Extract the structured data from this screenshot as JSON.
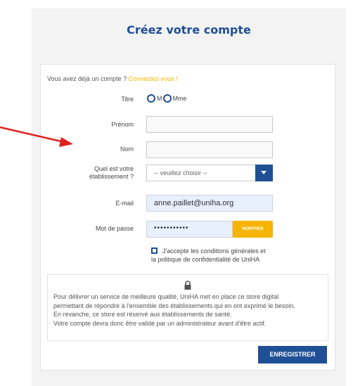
{
  "title": "Créez votre compte",
  "login_prompt": {
    "text": "Vous avez déjà un compte ?",
    "link": "Connectez-vous !"
  },
  "fields": {
    "titre": {
      "label": "Titre",
      "options": [
        "M",
        "Mme"
      ]
    },
    "prenom": {
      "label": "Prénom",
      "value": ""
    },
    "nom": {
      "label": "Nom",
      "value": ""
    },
    "etablissement": {
      "label_line1": "Quel est votre",
      "label_line2": "établissement ?",
      "selected": "-- veuillez choisir --"
    },
    "email": {
      "label": "E-mail",
      "value": "anne.paillet@uniha.org"
    },
    "password": {
      "label": "Mot de passe",
      "masked_value": "•••••••••••",
      "show_label": "MONTRER"
    }
  },
  "terms": {
    "line1": "J'accepte les conditions générales et",
    "line2": "la politique de confidentialité de UniHA"
  },
  "info": {
    "line1": "Pour délivrer un service de meilleure qualité, UniHA met en place ce store digital",
    "line2": "permettant de répondre à l'ensemble des établissements qui en ont exprimé le besoin.",
    "line3": "En revanche, ce store est réservé aux établissements de santé.",
    "line4": "Votre compte devra donc être validé par un administrateur avant d'être actif."
  },
  "submit_label": "ENREGISTRER",
  "colors": {
    "primary": "#1f4f95",
    "accent": "#f5b400",
    "arrow": "#e02020"
  },
  "icons": {
    "lock": "lock-icon",
    "dropdown": "chevron-down-icon",
    "annotation": "red-arrow"
  }
}
